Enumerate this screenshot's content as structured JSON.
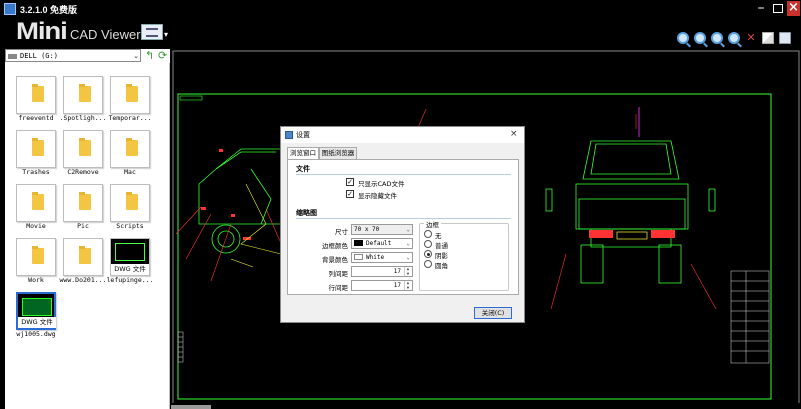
{
  "window": {
    "title": "3.2.1.0 免费版"
  },
  "toolbar": {
    "logo_mini": "Mini",
    "logo_app": "CAD Viewer",
    "view_dropdown": "▾"
  },
  "left_panel": {
    "drive": "DELL (G:)",
    "files": [
      {
        "name": "freeventd",
        "type": "folder"
      },
      {
        "name": ".Spotligh...",
        "type": "folder"
      },
      {
        "name": "Temporar...",
        "type": "folder"
      },
      {
        "name": "Trashes",
        "type": "folder"
      },
      {
        "name": "C2Remove",
        "type": "folder"
      },
      {
        "name": "Mac",
        "type": "folder"
      },
      {
        "name": "Movie",
        "type": "folder"
      },
      {
        "name": "Pic",
        "type": "folder"
      },
      {
        "name": "Scripts",
        "type": "folder"
      },
      {
        "name": "Work",
        "type": "folder"
      },
      {
        "name": "www.Do201...",
        "type": "folder"
      },
      {
        "name": "lefupinge...",
        "type": "dwg",
        "badge": "DWG 文件"
      },
      {
        "name": "wj1005.dwg",
        "type": "dwg",
        "badge": "DWG 文件"
      }
    ]
  },
  "dialog": {
    "title": "设置",
    "close_x": "×",
    "tabs": [
      "浏览窗口",
      "图纸浏览器"
    ],
    "file_section": "文件",
    "only_cad": "只显示CAD文件",
    "show_hidden": "显示隐藏文件",
    "thumb_section": "缩略图",
    "size_label": "尺寸",
    "size_value": "70 x 70",
    "border_color_label": "边框颜色",
    "border_color_value": "Default",
    "bg_color_label": "背景颜色",
    "bg_color_value": "White",
    "col_spacing_label": "列间距",
    "col_spacing_value": "17",
    "row_spacing_label": "行间距",
    "row_spacing_value": "17",
    "border_group": "边框",
    "border_options": [
      "无",
      "普通",
      "阴影",
      "圆角"
    ],
    "border_selected": "阴影",
    "close_button": "关闭(C)"
  },
  "colors": {
    "accent": "#2b6cd4",
    "drawing_bg": "#000000",
    "cad_green": "#33ff33",
    "cad_red": "#ff3333",
    "cad_yellow": "#ffff33"
  }
}
